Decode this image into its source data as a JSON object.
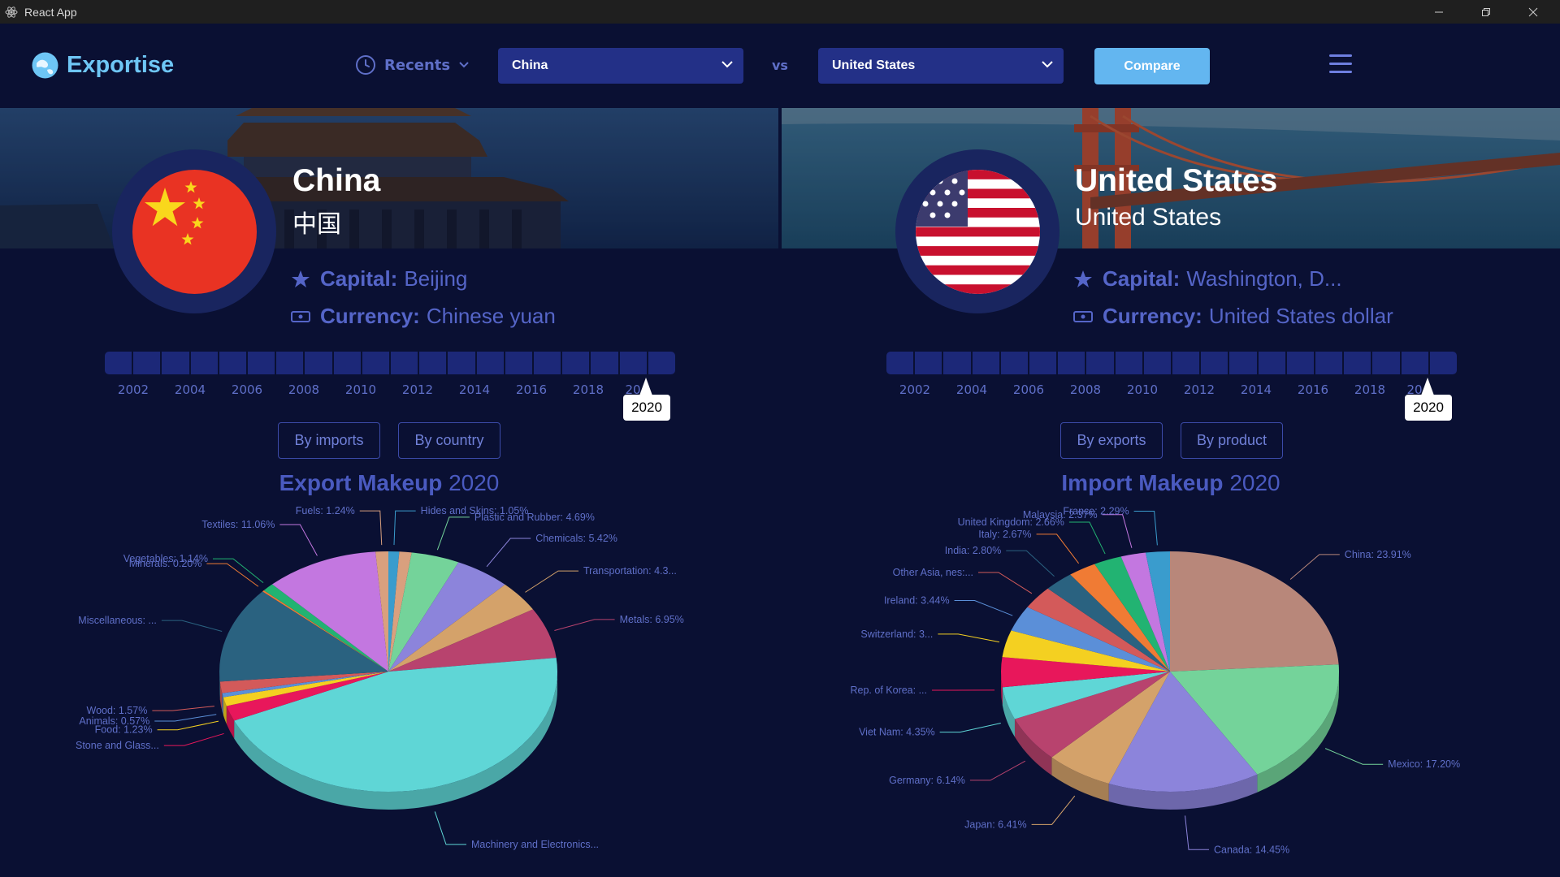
{
  "window": {
    "title": "React App"
  },
  "nav": {
    "logo": "Exportise",
    "recents": "Recents",
    "country_a": "China",
    "vs": "vs",
    "country_b": "United States",
    "compare": "Compare"
  },
  "left": {
    "name": "China",
    "native": "中国",
    "capital_label": "Capital:",
    "capital": "Beijing",
    "currency_label": "Currency:",
    "currency": "Chinese yuan",
    "years": [
      "2002",
      "2004",
      "2006",
      "2008",
      "2010",
      "2012",
      "2014",
      "2016",
      "2018",
      "20"
    ],
    "selected_year": "2020",
    "toggle1": "By imports",
    "toggle2": "By country",
    "chart_title": "Export Makeup",
    "chart_year": "2020"
  },
  "right": {
    "name": "United States",
    "native": "United States",
    "capital_label": "Capital:",
    "capital": "Washington, D...",
    "currency_label": "Currency:",
    "currency": "United States dollar",
    "years": [
      "2002",
      "2004",
      "2006",
      "2008",
      "2010",
      "2012",
      "2014",
      "2016",
      "2018",
      "20"
    ],
    "selected_year": "2020",
    "toggle1": "By exports",
    "toggle2": "By product",
    "chart_title": "Import Makeup",
    "chart_year": "2020"
  },
  "chart_data": [
    {
      "type": "pie",
      "title": "Export Makeup 2020",
      "series": [
        {
          "label": "Hides and Skins: 1.05%",
          "value": 1.05,
          "color": "#3a9ccd"
        },
        {
          "label": "",
          "value": 1.2,
          "color": "#d9a07e"
        },
        {
          "label": "Plastic and Rubber: 4.69%",
          "value": 4.69,
          "color": "#74d39a"
        },
        {
          "label": "Chemicals: 5.42%",
          "value": 5.42,
          "color": "#8c84db"
        },
        {
          "label": "Transportation: 4.3...",
          "value": 4.3,
          "color": "#d4a26a"
        },
        {
          "label": "Metals: 6.95%",
          "value": 6.95,
          "color": "#b8436e"
        },
        {
          "label": "Machinery and Electronics...",
          "value": 46.0,
          "color": "#5fd6d6"
        },
        {
          "label": "Stone and Glass...",
          "value": 2.1,
          "color": "#e8175b"
        },
        {
          "label": "Food: 1.23%",
          "value": 1.23,
          "color": "#f4d021"
        },
        {
          "label": "Animals: 0.57%",
          "value": 0.57,
          "color": "#5b8fd8"
        },
        {
          "label": "Wood: 1.57%",
          "value": 1.57,
          "color": "#d35a5a"
        },
        {
          "label": "Miscellaneous: ...",
          "value": 13.2,
          "color": "#2a6280"
        },
        {
          "label": "Minerals: 0.20%",
          "value": 0.2,
          "color": "#f07b34"
        },
        {
          "label": "Vegetables: 1.14%",
          "value": 1.14,
          "color": "#22b372"
        },
        {
          "label": "Textiles: 11.06%",
          "value": 11.06,
          "color": "#c377e0"
        },
        {
          "label": "Fuels: 1.24%",
          "value": 1.24,
          "color": "#d9a07e"
        }
      ]
    },
    {
      "type": "pie",
      "title": "Import Makeup 2020",
      "series": [
        {
          "label": "China: 23.91%",
          "value": 23.91,
          "color": "#b8877a"
        },
        {
          "label": "Mexico: 17.20%",
          "value": 17.2,
          "color": "#74d39a"
        },
        {
          "label": "Canada: 14.45%",
          "value": 14.45,
          "color": "#8c84db"
        },
        {
          "label": "Japan: 6.41%",
          "value": 6.41,
          "color": "#d4a26a"
        },
        {
          "label": "Germany: 6.14%",
          "value": 6.14,
          "color": "#b8436e"
        },
        {
          "label": "Viet Nam: 4.35%",
          "value": 4.35,
          "color": "#5fd6d6"
        },
        {
          "label": "Rep. of Korea: ...",
          "value": 4.0,
          "color": "#e8175b"
        },
        {
          "label": "Switzerland: 3...",
          "value": 3.6,
          "color": "#f4d021"
        },
        {
          "label": "Ireland: 3.44%",
          "value": 3.44,
          "color": "#5b8fd8"
        },
        {
          "label": "Other Asia, nes:...",
          "value": 3.1,
          "color": "#d35a5a"
        },
        {
          "label": "India: 2.80%",
          "value": 2.8,
          "color": "#2a6280"
        },
        {
          "label": "Italy: 2.67%",
          "value": 2.67,
          "color": "#f07b34"
        },
        {
          "label": "United Kingdom: 2.66%",
          "value": 2.66,
          "color": "#22b372"
        },
        {
          "label": "Malaysia: 2.37%",
          "value": 2.37,
          "color": "#c377e0"
        },
        {
          "label": "France: 2.29%",
          "value": 2.29,
          "color": "#3a9ccd"
        }
      ]
    }
  ]
}
